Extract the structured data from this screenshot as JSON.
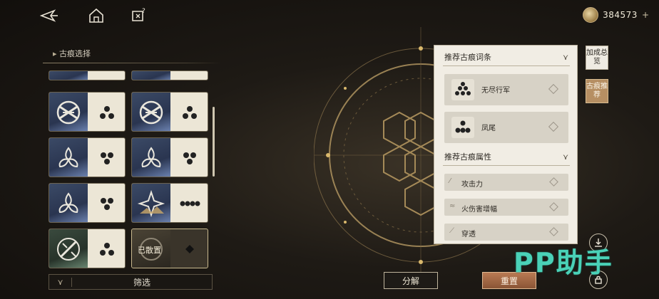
{
  "topbar": {
    "icons": [
      "back-arrow-icon",
      "home-icon",
      "help-icon"
    ],
    "currency_value": "384573",
    "currency_plus": "+"
  },
  "left_panel": {
    "section_title": "古痕选择",
    "cards": [
      {
        "icon": "knot-emblem-icon",
        "dots": "pyramid-3",
        "equipped": false
      },
      {
        "icon": "knot-emblem-icon",
        "dots": "pyramid-3",
        "equipped": false
      },
      {
        "icon": "trefoil-leaf-icon",
        "dots": "cluster-3",
        "equipped": false
      },
      {
        "icon": "trefoil-leaf-icon",
        "dots": "cluster-3",
        "equipped": false
      },
      {
        "icon": "trefoil-leaf-icon",
        "dots": "cluster-3",
        "equipped": false
      },
      {
        "icon": "mountain-star-icon",
        "dots": "pyramid-6",
        "equipped": false
      },
      {
        "icon": "broken-crest-icon",
        "dots": "pyramid-3",
        "equipped": false
      },
      {
        "icon": "equipped-crest-icon",
        "dots": "single",
        "equipped": true
      }
    ],
    "equipped_label": "已散置",
    "filter_label": "筛选",
    "filter_icon": "filter-icon"
  },
  "recommend": {
    "words_title": "推荐古痕词条",
    "words": [
      {
        "label": "无尽行军",
        "icon": "dot-pyramid-icon"
      },
      {
        "label": "凤尾",
        "icon": "dot-triangle-icon"
      }
    ],
    "attrs_title": "推荐古痕属性",
    "attrs": [
      {
        "label": "攻击力",
        "icon": "attack-stat-icon"
      },
      {
        "label": "火伤害增幅",
        "icon": "fire-dmg-stat-icon"
      },
      {
        "label": "穿透",
        "icon": "penetration-stat-icon"
      }
    ],
    "sort_icon": "sort-filter-icon"
  },
  "side_tabs": {
    "overview": "加成总览",
    "recommend": "古痕推荐"
  },
  "buttons": {
    "decompose": "分解",
    "reset": "重置"
  },
  "watermark": "PP助手",
  "colors": {
    "accent_gold": "#b68f63",
    "reset_button": "#a06842",
    "card_art_blue": "#3b4a66",
    "watermark_teal": "#4ad1b7"
  }
}
